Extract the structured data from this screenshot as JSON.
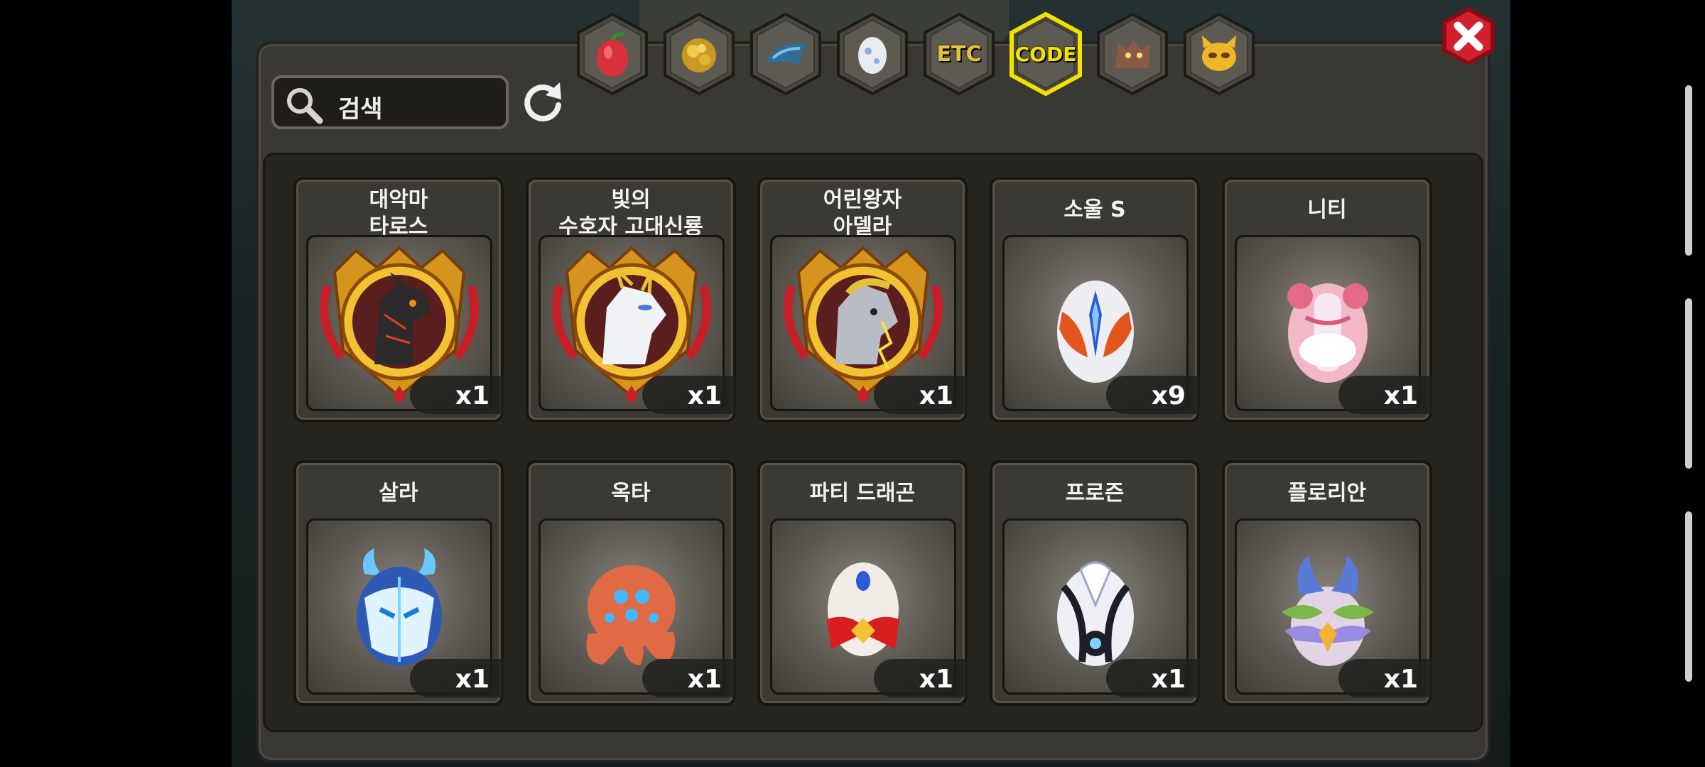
{
  "search": {
    "placeholder": "검색"
  },
  "tabs": [
    {
      "name": "fruit-icon"
    },
    {
      "name": "gold-ore-icon"
    },
    {
      "name": "dragon-wing-icon"
    },
    {
      "name": "egg-icon"
    },
    {
      "name": "etc-tab",
      "label": "ETC"
    },
    {
      "name": "code-tab",
      "label": "CODE",
      "active": true
    },
    {
      "name": "werewolf-icon"
    },
    {
      "name": "pet-mask-icon"
    }
  ],
  "items": [
    {
      "name": "대악마\n타로스",
      "qty": "x1",
      "icon": "dragon-medal-icon"
    },
    {
      "name": "빛의\n수호자 고대신룡",
      "qty": "x1",
      "icon": "white-dragon-medal-icon"
    },
    {
      "name": "어린왕자\n아델라",
      "qty": "x1",
      "icon": "robot-dragon-medal-icon"
    },
    {
      "name": "소울 S",
      "qty": "x9",
      "icon": "soul-egg-icon"
    },
    {
      "name": "니티",
      "qty": "x1",
      "icon": "pink-egg-icon"
    },
    {
      "name": "살라",
      "qty": "x1",
      "icon": "ice-dragon-egg-icon"
    },
    {
      "name": "옥타",
      "qty": "x1",
      "icon": "octopus-egg-icon"
    },
    {
      "name": "파티 드래곤",
      "qty": "x1",
      "icon": "ribbon-egg-icon"
    },
    {
      "name": "프로즌",
      "qty": "x1",
      "icon": "frozen-egg-icon"
    },
    {
      "name": "플로리안",
      "qty": "x1",
      "icon": "leaf-egg-icon"
    }
  ],
  "colors": {
    "active_tab": "#f3e100",
    "tab_gold": "#e8c13a",
    "close": "#d2202c"
  }
}
